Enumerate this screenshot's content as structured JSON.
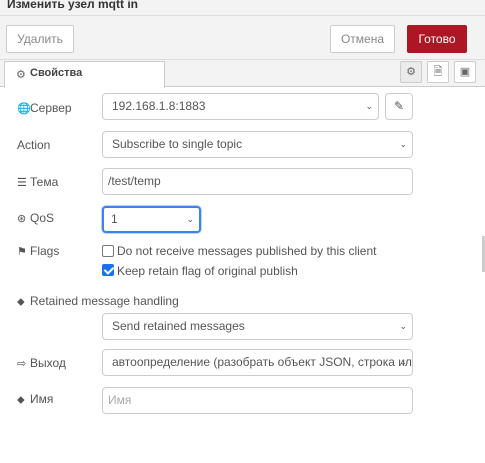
{
  "window": {
    "title": "Изменить узел mqtt in"
  },
  "toolbar": {
    "delete_label": "Удалить",
    "cancel_label": "Отмена",
    "done_label": "Готово"
  },
  "tabs": [
    {
      "label": "Свойства",
      "icon": "gear-icon"
    }
  ],
  "tab_buttons": [
    {
      "icon": "gear-icon"
    },
    {
      "icon": "document-icon"
    },
    {
      "icon": "frame-icon"
    }
  ],
  "form": {
    "server": {
      "label": "Сервер",
      "value": "192.168.1.8:1883",
      "icon": "globe-icon"
    },
    "action": {
      "label": "Action",
      "value": "Subscribe to single topic"
    },
    "topic": {
      "label": "Тема",
      "value": "/test/temp",
      "icon": "tasks-icon"
    },
    "qos": {
      "label": "QoS",
      "value": "1",
      "icon": "qos-icon"
    },
    "flags": {
      "label": "Flags",
      "icon": "flag-icon",
      "options": [
        {
          "text": "Do not receive messages published by this client",
          "checked": false
        },
        {
          "text": "Keep retain flag of original publish",
          "checked": true
        }
      ]
    },
    "retained": {
      "label": "Retained message handling",
      "value": "Send retained messages",
      "icon": "tag-icon"
    },
    "output": {
      "label": "Выход",
      "value": "автоопределение (разобрать объект JSON, строка или",
      "icon": "sign-out-icon"
    },
    "name": {
      "label": "Имя",
      "placeholder": "Имя",
      "value": "",
      "icon": "tag-icon"
    }
  },
  "colors": {
    "done_button": "#ad1625",
    "focus": "#3b82f6",
    "checkbox": "#1a73e8"
  }
}
